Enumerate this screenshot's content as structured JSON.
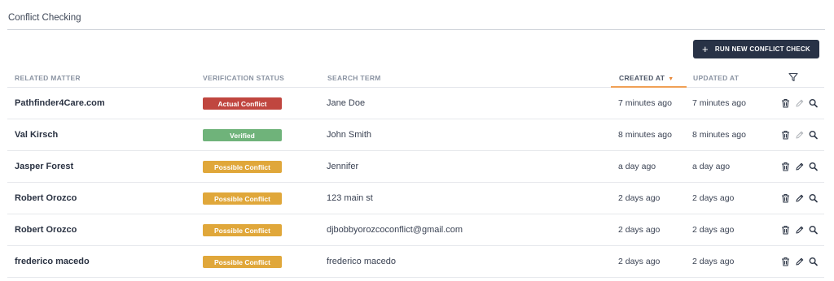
{
  "page": {
    "title": "Conflict Checking"
  },
  "toolbar": {
    "run_button_label": "RUN NEW CONFLICT CHECK",
    "run_button_icon": "plus-icon"
  },
  "table": {
    "columns": {
      "related_matter": "RELATED MATTER",
      "verification_status": "VERIFICATION STATUS",
      "search_term": "SEARCH TERM",
      "created_at": "CREATED AT",
      "updated_at": "UPDATED AT"
    },
    "sorted_by": "created_at",
    "sort_direction": "desc",
    "status_colors": {
      "Actual Conflict": "#c0463f",
      "Verified": "#6fb37a",
      "Possible Conflict": "#e0a73a"
    },
    "rows": [
      {
        "matter": "Pathfinder4Care.com",
        "status": "Actual Conflict",
        "term": "Jane Doe",
        "created": "7 minutes ago",
        "updated": "7 minutes ago",
        "edit_enabled": false
      },
      {
        "matter": "Val Kirsch",
        "status": "Verified",
        "term": "John Smith",
        "created": "8 minutes ago",
        "updated": "8 minutes ago",
        "edit_enabled": false
      },
      {
        "matter": "Jasper Forest",
        "status": "Possible Conflict",
        "term": "Jennifer",
        "created": "a day ago",
        "updated": "a day ago",
        "edit_enabled": true
      },
      {
        "matter": "Robert Orozco",
        "status": "Possible Conflict",
        "term": "123 main st",
        "created": "2 days ago",
        "updated": "2 days ago",
        "edit_enabled": true
      },
      {
        "matter": "Robert Orozco",
        "status": "Possible Conflict",
        "term": "djbobbyorozcoconflict@gmail.com",
        "created": "2 days ago",
        "updated": "2 days ago",
        "edit_enabled": true
      },
      {
        "matter": "frederico macedo",
        "status": "Possible Conflict",
        "term": "frederico macedo",
        "created": "2 days ago",
        "updated": "2 days ago",
        "edit_enabled": true
      }
    ]
  }
}
